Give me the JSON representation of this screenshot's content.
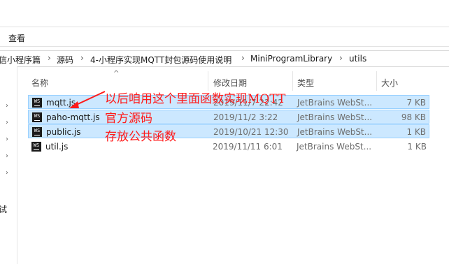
{
  "ribbon": {
    "view_tab": "查看"
  },
  "breadcrumbs": [
    {
      "label": "信小程序篇"
    },
    {
      "label": "源码"
    },
    {
      "label": "4-小程序实现MQTT封包源码使用说明"
    },
    {
      "label": "MiniProgramLibrary"
    },
    {
      "label": "utils"
    }
  ],
  "columns": {
    "name": "名称",
    "modified": "修改日期",
    "type": "类型",
    "size": "大小"
  },
  "files": [
    {
      "name": "mqtt.js",
      "modified": "2019/11/7 22:42",
      "type": "JetBrains WebSt...",
      "size": "7 KB",
      "icon": "webstorm-file-icon",
      "selected": true
    },
    {
      "name": "paho-mqtt.js",
      "modified": "2019/11/2 3:22",
      "type": "JetBrains WebSt...",
      "size": "98 KB",
      "icon": "webstorm-file-icon",
      "selected": true
    },
    {
      "name": "public.js",
      "modified": "2019/10/21 12:30",
      "type": "JetBrains WebSt...",
      "size": "1 KB",
      "icon": "webstorm-file-icon",
      "selected": true
    },
    {
      "name": "util.js",
      "modified": "2019/11/11 6:01",
      "type": "JetBrains WebSt...",
      "size": "1 KB",
      "icon": "webstorm-file-icon",
      "selected": false
    }
  ],
  "annotations": [
    {
      "text": "以后咱用这个里面函数实现MQTT"
    },
    {
      "text": "官方源码"
    },
    {
      "text": "存放公共函数"
    }
  ],
  "nav_fragment": "试",
  "colors": {
    "selection": "#cce8ff",
    "selection_border": "#99d1ff",
    "annotation": "#ff1a1a"
  }
}
